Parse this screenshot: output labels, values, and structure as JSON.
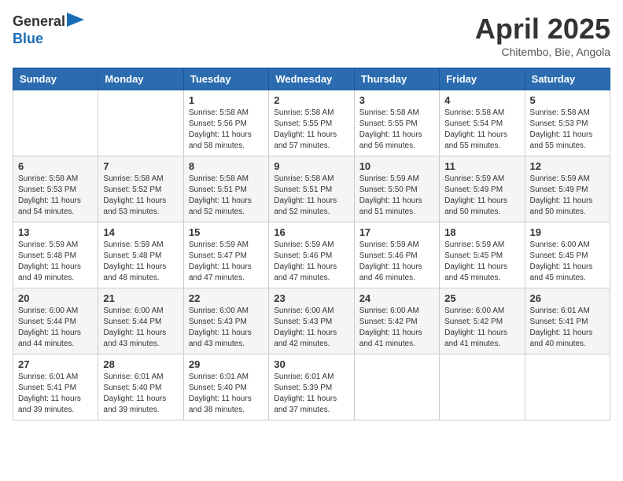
{
  "header": {
    "logo_general": "General",
    "logo_blue": "Blue",
    "title": "April 2025",
    "location": "Chitembo, Bie, Angola"
  },
  "weekdays": [
    "Sunday",
    "Monday",
    "Tuesday",
    "Wednesday",
    "Thursday",
    "Friday",
    "Saturday"
  ],
  "weeks": [
    [
      {
        "day": "",
        "sunrise": "",
        "sunset": "",
        "daylight": ""
      },
      {
        "day": "",
        "sunrise": "",
        "sunset": "",
        "daylight": ""
      },
      {
        "day": "1",
        "sunrise": "Sunrise: 5:58 AM",
        "sunset": "Sunset: 5:56 PM",
        "daylight": "Daylight: 11 hours and 58 minutes."
      },
      {
        "day": "2",
        "sunrise": "Sunrise: 5:58 AM",
        "sunset": "Sunset: 5:55 PM",
        "daylight": "Daylight: 11 hours and 57 minutes."
      },
      {
        "day": "3",
        "sunrise": "Sunrise: 5:58 AM",
        "sunset": "Sunset: 5:55 PM",
        "daylight": "Daylight: 11 hours and 56 minutes."
      },
      {
        "day": "4",
        "sunrise": "Sunrise: 5:58 AM",
        "sunset": "Sunset: 5:54 PM",
        "daylight": "Daylight: 11 hours and 55 minutes."
      },
      {
        "day": "5",
        "sunrise": "Sunrise: 5:58 AM",
        "sunset": "Sunset: 5:53 PM",
        "daylight": "Daylight: 11 hours and 55 minutes."
      }
    ],
    [
      {
        "day": "6",
        "sunrise": "Sunrise: 5:58 AM",
        "sunset": "Sunset: 5:53 PM",
        "daylight": "Daylight: 11 hours and 54 minutes."
      },
      {
        "day": "7",
        "sunrise": "Sunrise: 5:58 AM",
        "sunset": "Sunset: 5:52 PM",
        "daylight": "Daylight: 11 hours and 53 minutes."
      },
      {
        "day": "8",
        "sunrise": "Sunrise: 5:58 AM",
        "sunset": "Sunset: 5:51 PM",
        "daylight": "Daylight: 11 hours and 52 minutes."
      },
      {
        "day": "9",
        "sunrise": "Sunrise: 5:58 AM",
        "sunset": "Sunset: 5:51 PM",
        "daylight": "Daylight: 11 hours and 52 minutes."
      },
      {
        "day": "10",
        "sunrise": "Sunrise: 5:59 AM",
        "sunset": "Sunset: 5:50 PM",
        "daylight": "Daylight: 11 hours and 51 minutes."
      },
      {
        "day": "11",
        "sunrise": "Sunrise: 5:59 AM",
        "sunset": "Sunset: 5:49 PM",
        "daylight": "Daylight: 11 hours and 50 minutes."
      },
      {
        "day": "12",
        "sunrise": "Sunrise: 5:59 AM",
        "sunset": "Sunset: 5:49 PM",
        "daylight": "Daylight: 11 hours and 50 minutes."
      }
    ],
    [
      {
        "day": "13",
        "sunrise": "Sunrise: 5:59 AM",
        "sunset": "Sunset: 5:48 PM",
        "daylight": "Daylight: 11 hours and 49 minutes."
      },
      {
        "day": "14",
        "sunrise": "Sunrise: 5:59 AM",
        "sunset": "Sunset: 5:48 PM",
        "daylight": "Daylight: 11 hours and 48 minutes."
      },
      {
        "day": "15",
        "sunrise": "Sunrise: 5:59 AM",
        "sunset": "Sunset: 5:47 PM",
        "daylight": "Daylight: 11 hours and 47 minutes."
      },
      {
        "day": "16",
        "sunrise": "Sunrise: 5:59 AM",
        "sunset": "Sunset: 5:46 PM",
        "daylight": "Daylight: 11 hours and 47 minutes."
      },
      {
        "day": "17",
        "sunrise": "Sunrise: 5:59 AM",
        "sunset": "Sunset: 5:46 PM",
        "daylight": "Daylight: 11 hours and 46 minutes."
      },
      {
        "day": "18",
        "sunrise": "Sunrise: 5:59 AM",
        "sunset": "Sunset: 5:45 PM",
        "daylight": "Daylight: 11 hours and 45 minutes."
      },
      {
        "day": "19",
        "sunrise": "Sunrise: 6:00 AM",
        "sunset": "Sunset: 5:45 PM",
        "daylight": "Daylight: 11 hours and 45 minutes."
      }
    ],
    [
      {
        "day": "20",
        "sunrise": "Sunrise: 6:00 AM",
        "sunset": "Sunset: 5:44 PM",
        "daylight": "Daylight: 11 hours and 44 minutes."
      },
      {
        "day": "21",
        "sunrise": "Sunrise: 6:00 AM",
        "sunset": "Sunset: 5:44 PM",
        "daylight": "Daylight: 11 hours and 43 minutes."
      },
      {
        "day": "22",
        "sunrise": "Sunrise: 6:00 AM",
        "sunset": "Sunset: 5:43 PM",
        "daylight": "Daylight: 11 hours and 43 minutes."
      },
      {
        "day": "23",
        "sunrise": "Sunrise: 6:00 AM",
        "sunset": "Sunset: 5:43 PM",
        "daylight": "Daylight: 11 hours and 42 minutes."
      },
      {
        "day": "24",
        "sunrise": "Sunrise: 6:00 AM",
        "sunset": "Sunset: 5:42 PM",
        "daylight": "Daylight: 11 hours and 41 minutes."
      },
      {
        "day": "25",
        "sunrise": "Sunrise: 6:00 AM",
        "sunset": "Sunset: 5:42 PM",
        "daylight": "Daylight: 11 hours and 41 minutes."
      },
      {
        "day": "26",
        "sunrise": "Sunrise: 6:01 AM",
        "sunset": "Sunset: 5:41 PM",
        "daylight": "Daylight: 11 hours and 40 minutes."
      }
    ],
    [
      {
        "day": "27",
        "sunrise": "Sunrise: 6:01 AM",
        "sunset": "Sunset: 5:41 PM",
        "daylight": "Daylight: 11 hours and 39 minutes."
      },
      {
        "day": "28",
        "sunrise": "Sunrise: 6:01 AM",
        "sunset": "Sunset: 5:40 PM",
        "daylight": "Daylight: 11 hours and 39 minutes."
      },
      {
        "day": "29",
        "sunrise": "Sunrise: 6:01 AM",
        "sunset": "Sunset: 5:40 PM",
        "daylight": "Daylight: 11 hours and 38 minutes."
      },
      {
        "day": "30",
        "sunrise": "Sunrise: 6:01 AM",
        "sunset": "Sunset: 5:39 PM",
        "daylight": "Daylight: 11 hours and 37 minutes."
      },
      {
        "day": "",
        "sunrise": "",
        "sunset": "",
        "daylight": ""
      },
      {
        "day": "",
        "sunrise": "",
        "sunset": "",
        "daylight": ""
      },
      {
        "day": "",
        "sunrise": "",
        "sunset": "",
        "daylight": ""
      }
    ]
  ]
}
